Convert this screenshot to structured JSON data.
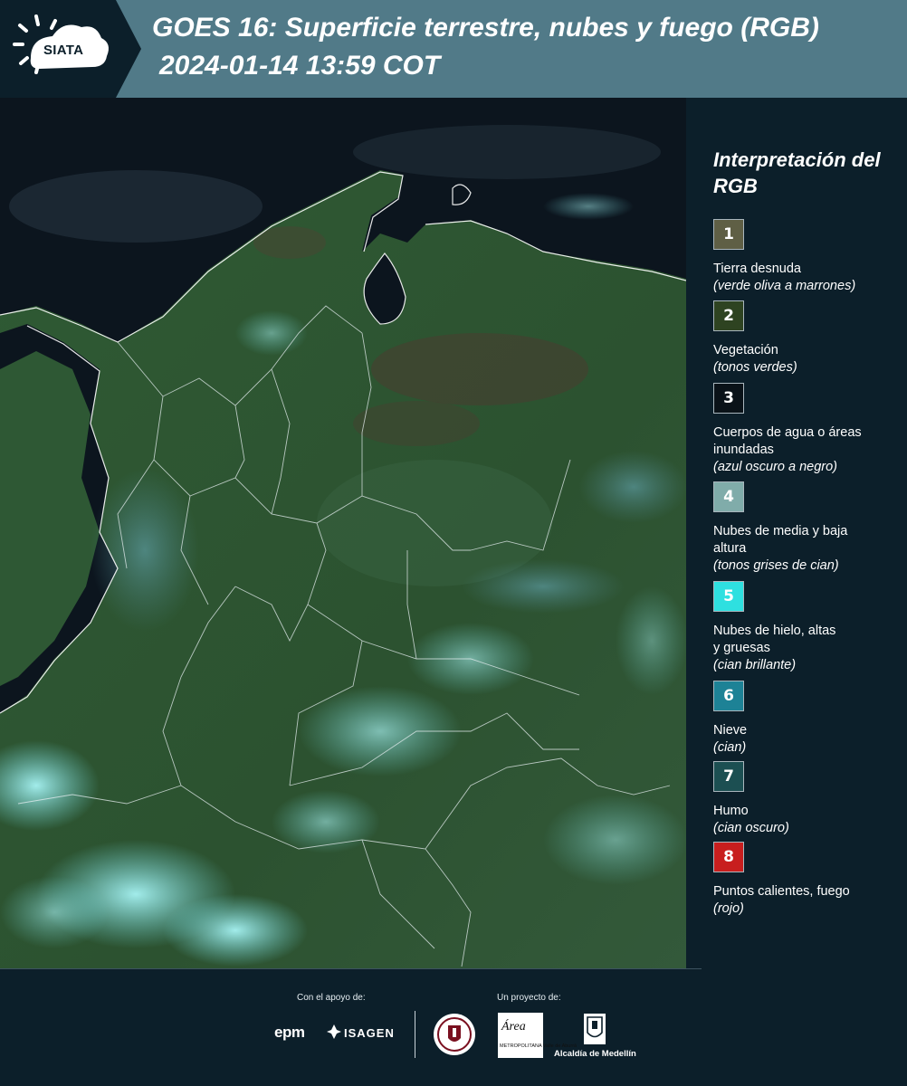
{
  "header": {
    "logo_text": "SIATA",
    "title_line1": "GOES 16: Superficie terrestre, nubes y fuego (RGB)",
    "title_line2": "2024-01-14 13:59 COT",
    "colors": {
      "header_bg": "#517a88",
      "page_bg": "#0c1f2a"
    }
  },
  "legend": {
    "title": "Interpretación del RGB",
    "items": [
      {
        "num": "1",
        "name": "Tierra desnuda",
        "desc": "(verde oliva a marrones)",
        "color": "#5f5f45"
      },
      {
        "num": "2",
        "name": "Vegetación",
        "desc": "(tonos verdes)",
        "color": "#2e4321"
      },
      {
        "num": "3",
        "name": "Cuerpos de agua o áreas inundadas",
        "desc": "(azul oscuro a negro)",
        "color": "#0a1218"
      },
      {
        "num": "4",
        "name": "Nubes de media y baja altura",
        "desc": "(tonos grises de cian)",
        "color": "#80acaa"
      },
      {
        "num": "5",
        "name": "Nubes de hielo, altas y gruesas",
        "desc": "(cian brillante)",
        "color": "#2ee0e0"
      },
      {
        "num": "6",
        "name": "Nieve",
        "desc": "(cian)",
        "color": "#1d8296"
      },
      {
        "num": "7",
        "name": "Humo",
        "desc": "(cian oscuro)",
        "color": "#1c4f52"
      },
      {
        "num": "8",
        "name": "Puntos calientes, fuego",
        "desc": "(rojo)",
        "color": "#c81e1e"
      }
    ]
  },
  "footer": {
    "support_label": "Con el apoyo de:",
    "project_label": "Un proyecto de:",
    "sponsor_epm": "epm",
    "sponsor_isagen": "ISAGEN",
    "area_logo_text": "Área",
    "area_logo_sub": "METROPOLITANA Valle de Aburrá",
    "alcaldia": "Alcaldía de Medellín"
  }
}
